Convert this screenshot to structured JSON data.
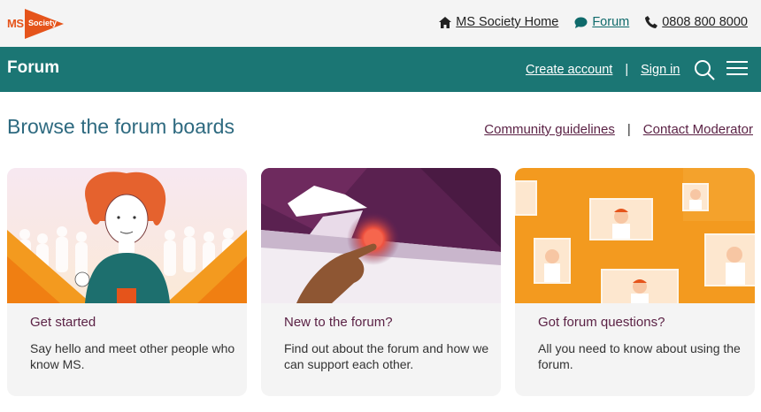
{
  "logo": {
    "ms": "MS",
    "society": "Society"
  },
  "top_links": {
    "home": "MS Society Home",
    "forum": "Forum",
    "phone": "0808 800 8000"
  },
  "header": {
    "title": "Forum",
    "create_account": "Create account",
    "separator": "|",
    "sign_in": "Sign in"
  },
  "browse": {
    "title": "Browse the forum boards",
    "community_guidelines": "Community guidelines",
    "separator": "|",
    "contact_moderator": "Contact Moderator"
  },
  "cards": [
    {
      "title": "Get started",
      "description": "Say hello and meet other people who know MS."
    },
    {
      "title": "New to the forum?",
      "description": "Find out about the forum and how we can support each other."
    },
    {
      "title": "Got forum questions?",
      "description": "All you need to know about using the forum."
    }
  ],
  "colors": {
    "teal": "#1b7674",
    "accent_purple": "#5b2245",
    "brand_orange": "#e5541b"
  }
}
